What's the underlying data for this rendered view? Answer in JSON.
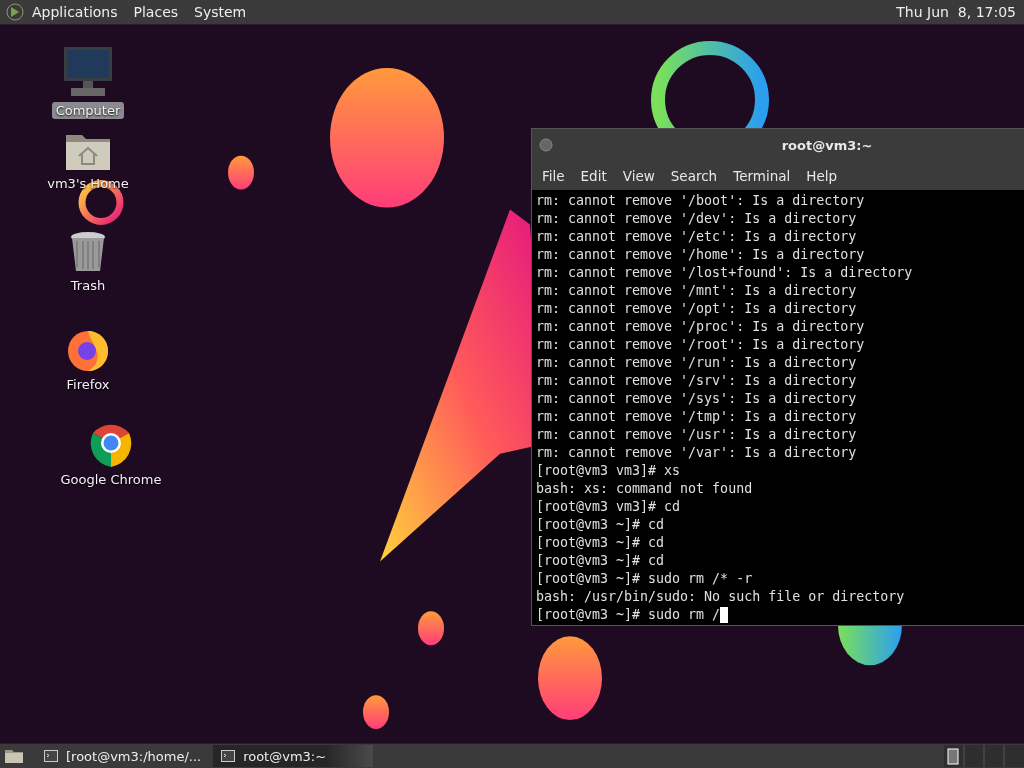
{
  "top_panel": {
    "menus": [
      {
        "label": "Applications"
      },
      {
        "label": "Places"
      },
      {
        "label": "System"
      }
    ],
    "clock": "Thu Jun  8, 17:05"
  },
  "desktop_icons": [
    {
      "kind": "computer",
      "label": "Computer",
      "selected": true
    },
    {
      "kind": "home",
      "label": "vm3's Home",
      "selected": false
    },
    {
      "kind": "trash",
      "label": "Trash",
      "selected": false
    },
    {
      "kind": "firefox",
      "label": "Firefox",
      "selected": false
    },
    {
      "kind": "chrome",
      "label": "Google Chrome",
      "selected": false
    }
  ],
  "terminal": {
    "title": "root@vm3:~",
    "menus": [
      "File",
      "Edit",
      "View",
      "Search",
      "Terminal",
      "Help"
    ],
    "lines": [
      "rm: cannot remove '/boot': Is a directory",
      "rm: cannot remove '/dev': Is a directory",
      "rm: cannot remove '/etc': Is a directory",
      "rm: cannot remove '/home': Is a directory",
      "rm: cannot remove '/lost+found': Is a directory",
      "rm: cannot remove '/mnt': Is a directory",
      "rm: cannot remove '/opt': Is a directory",
      "rm: cannot remove '/proc': Is a directory",
      "rm: cannot remove '/root': Is a directory",
      "rm: cannot remove '/run': Is a directory",
      "rm: cannot remove '/srv': Is a directory",
      "rm: cannot remove '/sys': Is a directory",
      "rm: cannot remove '/tmp': Is a directory",
      "rm: cannot remove '/usr': Is a directory",
      "rm: cannot remove '/var': Is a directory",
      "[root@vm3 vm3]# xs",
      "bash: xs: command not found",
      "[root@vm3 vm3]# cd",
      "[root@vm3 ~]# cd",
      "[root@vm3 ~]# cd",
      "[root@vm3 ~]# cd",
      "[root@vm3 ~]# sudo rm /* -r",
      "bash: /usr/bin/sudo: No such file or directory",
      "[root@vm3 ~]# sudo rm /"
    ],
    "cursor": true
  },
  "taskbar": {
    "tasks": [
      {
        "label": "[root@vm3:/home/...",
        "selected": false
      },
      {
        "label": "root@vm3:~",
        "selected": true
      }
    ]
  }
}
